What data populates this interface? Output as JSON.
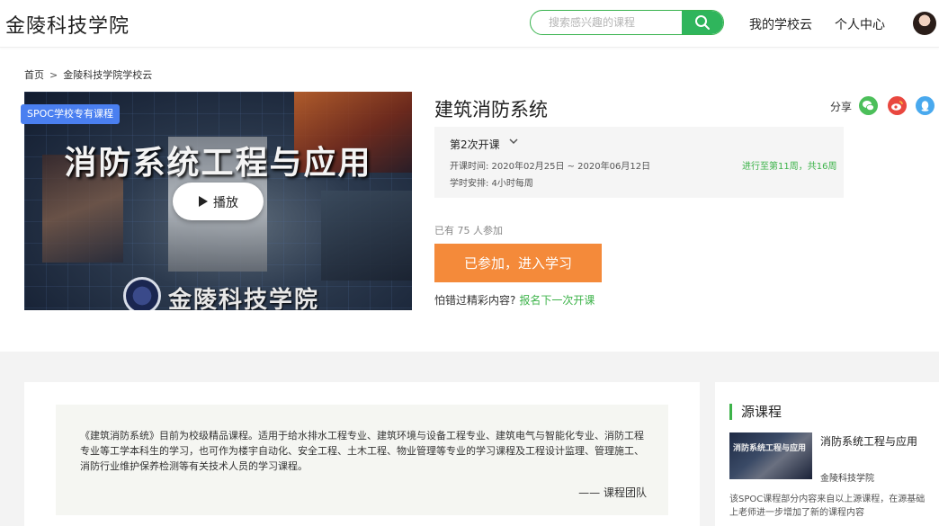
{
  "header": {
    "brand": "金陵科技学院",
    "search_placeholder": "搜索感兴趣的课程",
    "nav": [
      "我的学校云",
      "个人中心"
    ]
  },
  "breadcrumb": [
    "首页",
    ">",
    "金陵科技学院学校云"
  ],
  "video": {
    "badge": "SPOC学校专有课程",
    "title_text": "消防系统工程与应用",
    "school_text": "金陵科技学院",
    "play_label": "播放"
  },
  "course": {
    "title": "建筑消防系统",
    "share_label": "分享",
    "term": "第2次开课",
    "dates": "开课时间:   2020年02月25日 ~ 2020年06月12日",
    "schedule": "学时安排:   4小时每周",
    "progress": "进行至第11周，共16周",
    "joined": "已有 75 人参加",
    "enter_label": "已参加，进入学习",
    "miss_text": "怕错过精彩内容?",
    "miss_link": "报名下一次开课"
  },
  "description": {
    "text": "《建筑消防系统》目前为校级精品课程。适用于给水排水工程专业、建筑环境与设备工程专业、建筑电气与智能化专业、消防工程专业等工学本科生的学习，也可作为楼宇自动化、安全工程、土木工程、物业管理等专业的学习课程及工程设计监理、管理施工、消防行业维护保养检测等有关技术人员的学习课程。",
    "sign": "—— 课程团队"
  },
  "source": {
    "heading": "源课程",
    "thumb_text": "消防系统工程与应用",
    "name": "消防系统工程与应用",
    "school": "金陵科技学院",
    "note": "该SPOC课程部分内容来自以上源课程，在源基础上老师进一步增加了新的课程内容"
  },
  "colors": {
    "accent_green": "#3db34a",
    "button_orange": "#f48a3a",
    "badge_blue": "#4a7ff0"
  }
}
